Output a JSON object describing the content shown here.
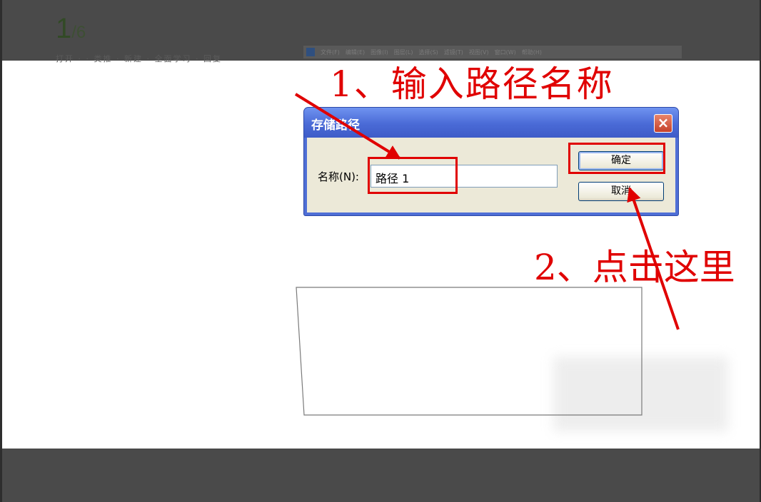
{
  "viewer": {
    "page_current": "1",
    "page_total": "/6",
    "faint_menu": "打开 · · 类推 · 新建 · 全面学习 · 回复"
  },
  "ps_menubar": {
    "items": [
      "文件(F)",
      "编辑(E)",
      "图像(I)",
      "图层(L)",
      "选择(S)",
      "滤镜(T)",
      "视图(V)",
      "窗口(W)",
      "帮助(H)"
    ]
  },
  "annotations": {
    "step1": "1、输入路径名称",
    "step2": "2、点击这里",
    "color": "#e00000"
  },
  "dialog": {
    "title": "存储路径",
    "close_icon": "×",
    "name_label": "名称(N):",
    "name_value": "路径 1",
    "ok_label": "确定",
    "cancel_label": "取消"
  },
  "colors": {
    "title_bar": "#4a6ad6",
    "dialog_body": "#ece9d8",
    "dark_bar": "#4a4a4a"
  }
}
